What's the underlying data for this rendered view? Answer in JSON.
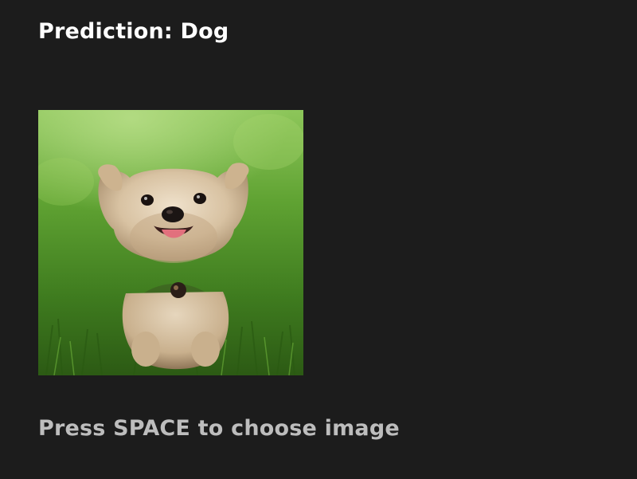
{
  "prediction": {
    "label": "Prediction: Dog"
  },
  "image": {
    "subject": "dog-photo",
    "colors": {
      "grass_light": "#7fc04a",
      "grass_dark": "#2e5e16",
      "fur": "#d9c4a6",
      "fur_shadow": "#a88e6d",
      "tongue": "#e2707d",
      "nose": "#1b1514"
    }
  },
  "instructions": {
    "hint": "Press SPACE to choose image"
  }
}
